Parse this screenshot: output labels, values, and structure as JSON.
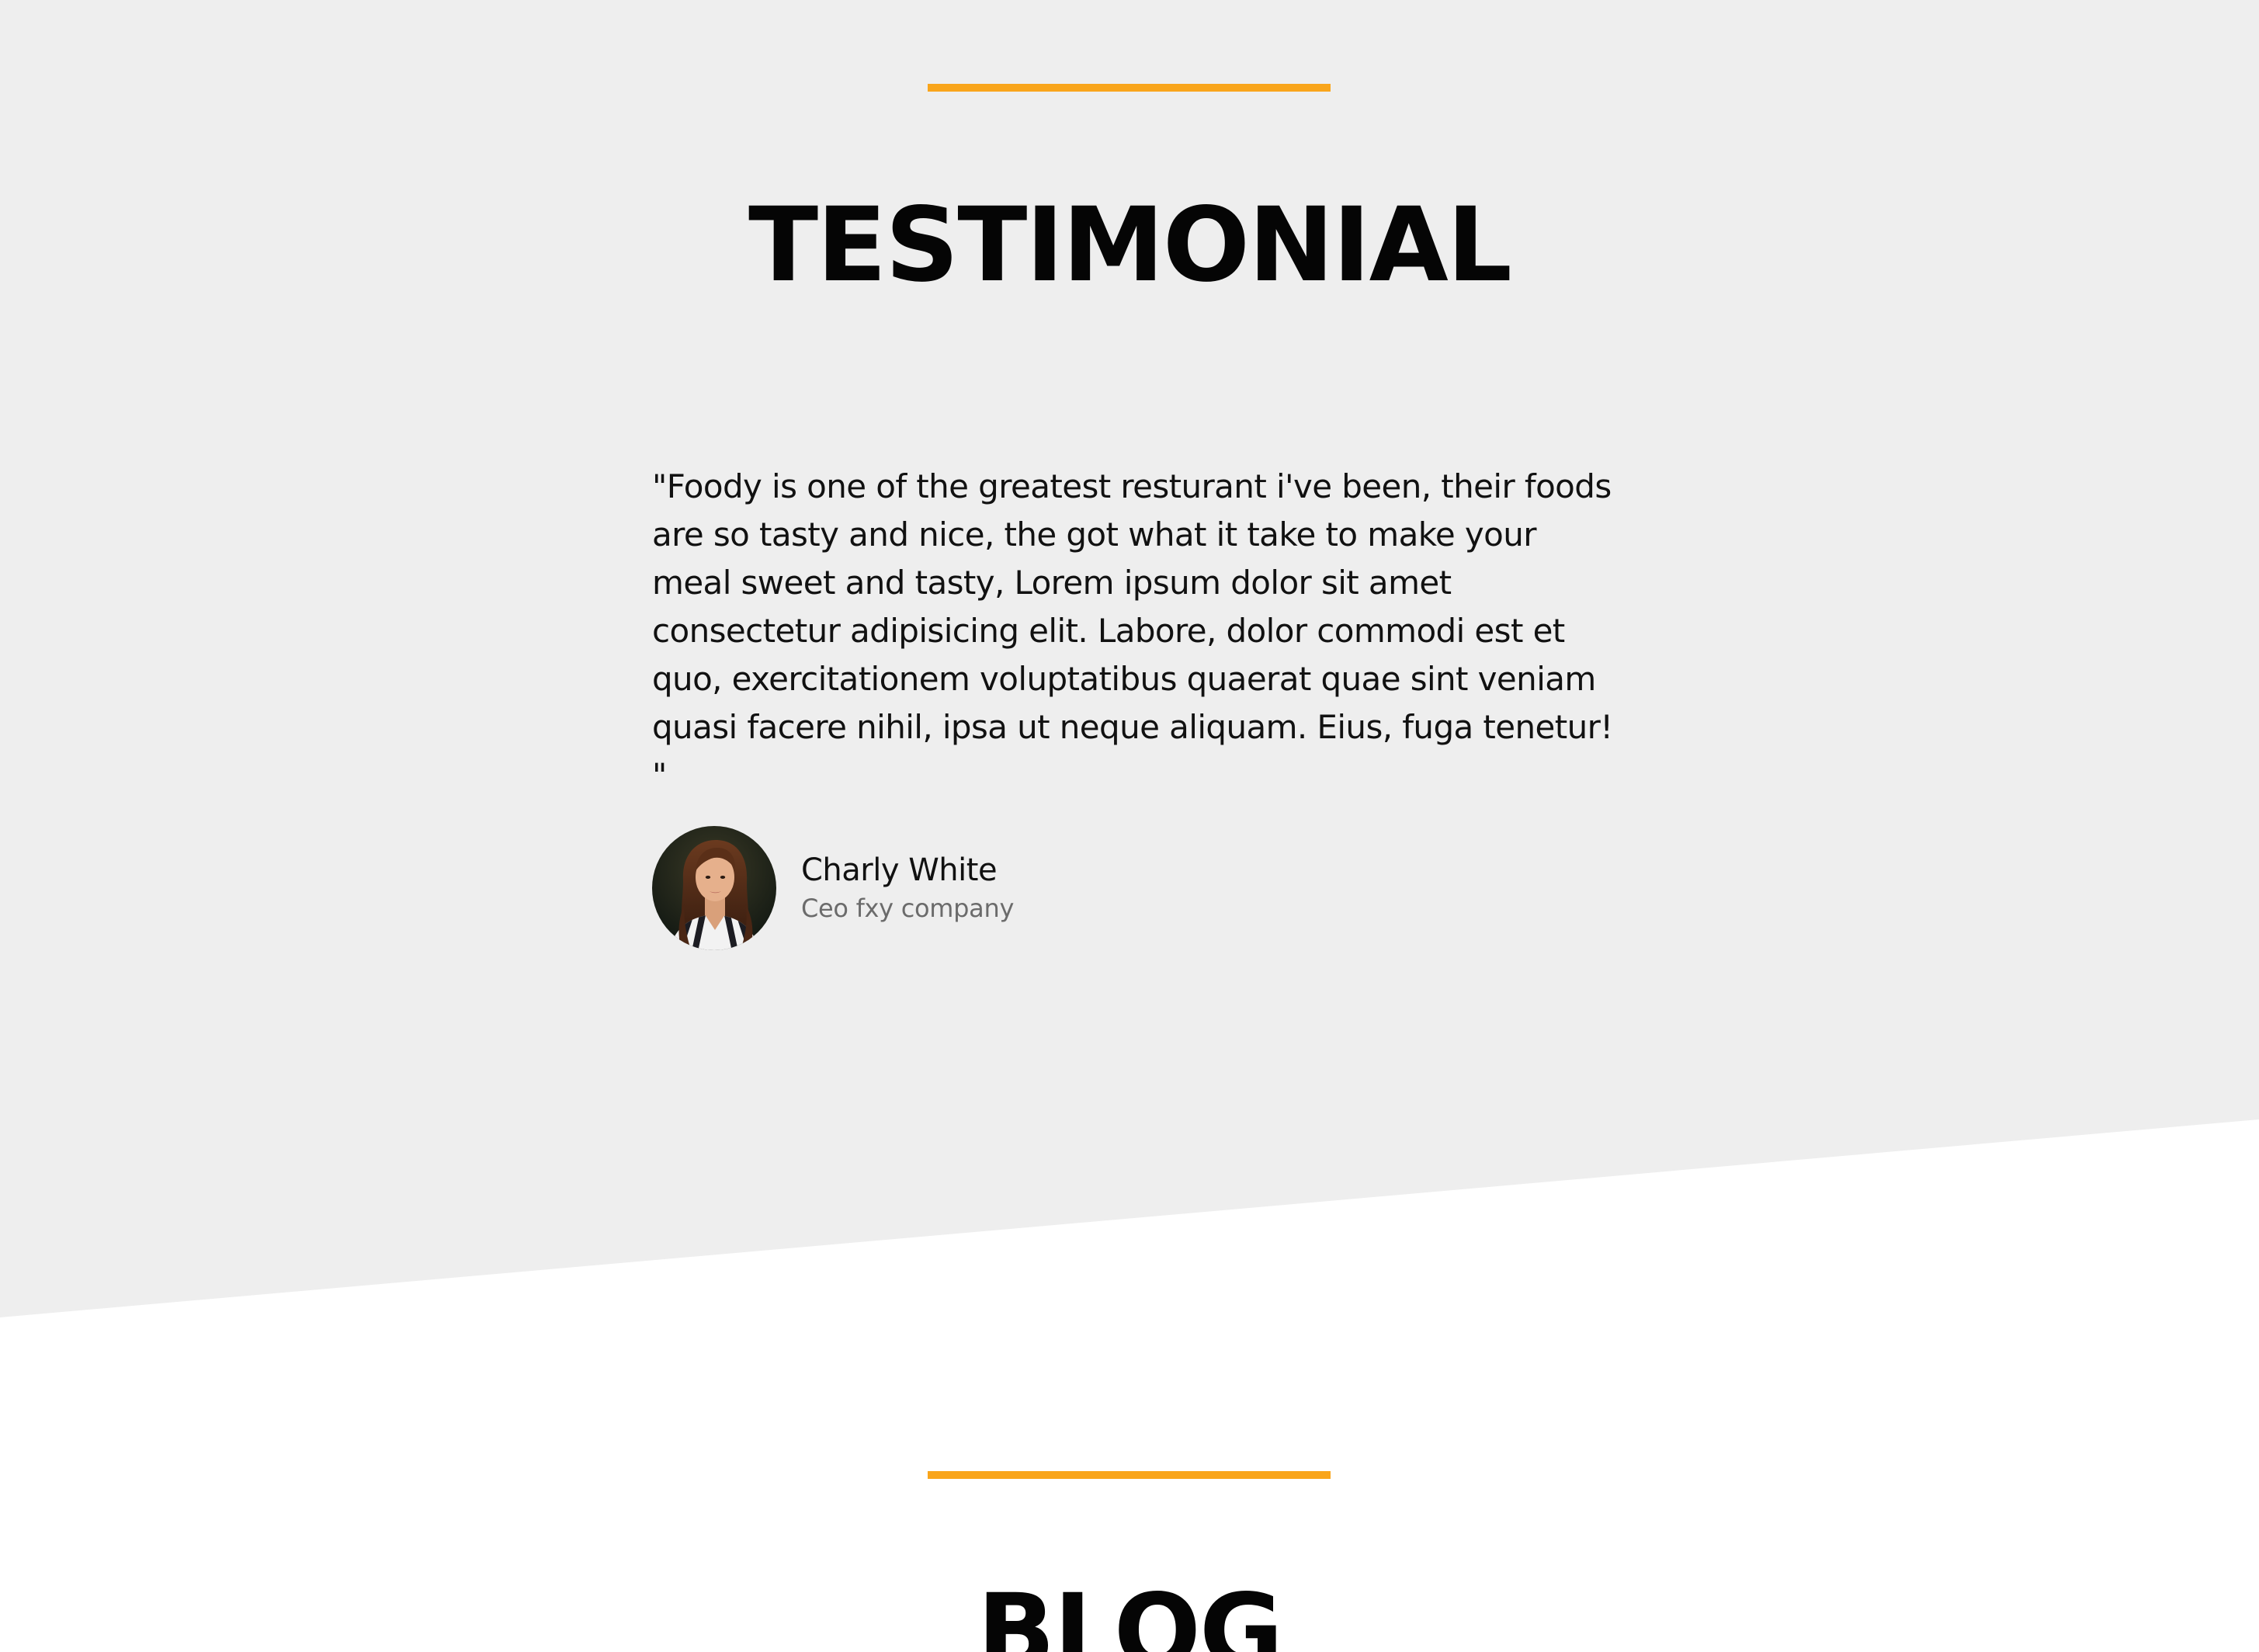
{
  "testimonial": {
    "title": "TESTIMONIAL",
    "quote": "\"Foody is one of the greatest resturant i've been, their foods are so tasty and nice, the got what it take to make your meal sweet and tasty, Lorem ipsum dolor sit amet consectetur adipisicing elit. Labore, dolor commodi est et quo, exercitationem voluptatibus quaerat quae sint veniam quasi facere nihil, ipsa ut neque aliquam. Eius, fuga tenetur! \"",
    "author": {
      "name": "Charly White",
      "role": "Ceo fxy company"
    }
  },
  "blog": {
    "title": "BLOG"
  },
  "colors": {
    "accent": "#f9a51b",
    "section_background": "#eeeeee",
    "page_background": "#ffffff",
    "heading": "#050505",
    "body_text": "#111111",
    "muted_text": "#6b6b6b"
  }
}
